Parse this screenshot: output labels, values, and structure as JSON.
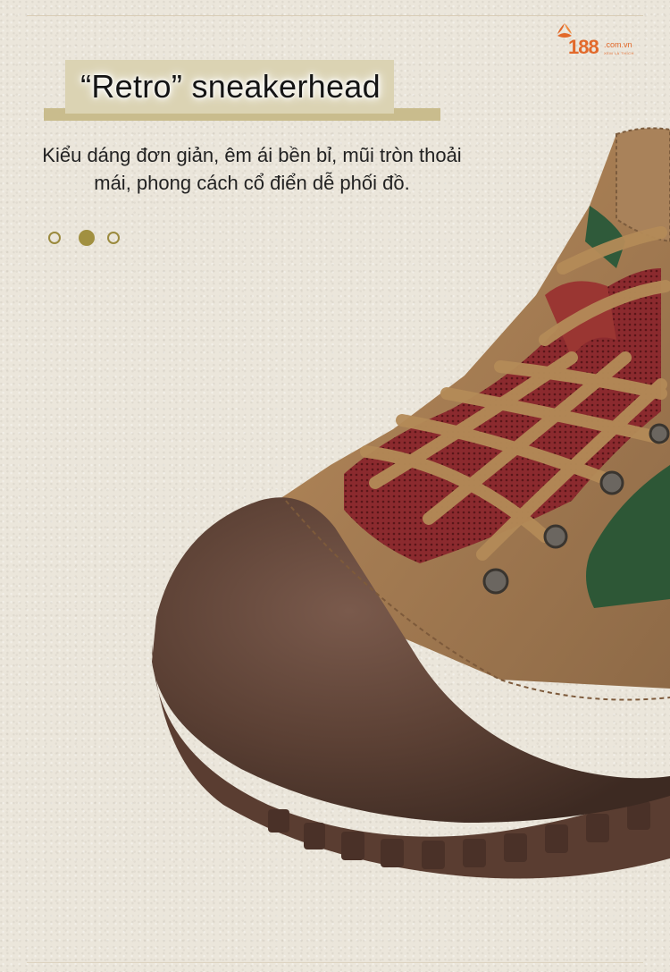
{
  "brand": {
    "logo_number": "188",
    "logo_domain": ".com.vn",
    "logo_tagline": "XEM LÀ THÍCH",
    "accent_color": "#e2692a"
  },
  "headline": {
    "title": "“Retro” sneakerhead",
    "description_line1": "Kiểu dáng đơn giản, êm ái bền bỉ, mũi tròn thoải",
    "description_line2": "mái, phong cách cổ điển dễ phối đồ."
  },
  "carousel": {
    "dots": [
      "inactive",
      "active",
      "inactive"
    ],
    "color": "#9b8a3e"
  },
  "product": {
    "icon": "retro-sneaker-boot-image",
    "colors": [
      "#a57a4f",
      "#5a3e33",
      "#2f5a3a",
      "#8a2a2e"
    ]
  }
}
